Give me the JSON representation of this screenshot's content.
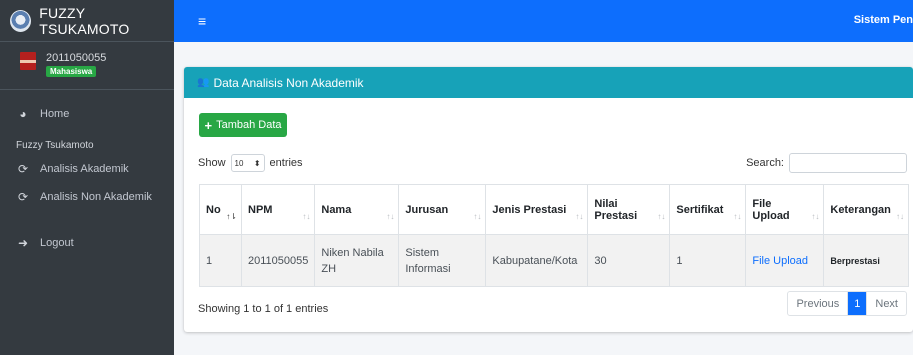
{
  "brand": {
    "name": "FUZZY TSUKAMOTO"
  },
  "user": {
    "id": "2011050055",
    "role": "Mahasiswa"
  },
  "nav": {
    "home": "Home",
    "section_header": "Fuzzy Tsukamoto",
    "analisis_akademik": "Analisis Akademik",
    "analisis_non_akademik": "Analisis Non Akademik",
    "logout": "Logout"
  },
  "topbar": {
    "system_title": "Sistem Pen"
  },
  "card": {
    "title": "Data Analisis Non Akademik",
    "add_button": "Tambah Data"
  },
  "datatable": {
    "show_label": "Show",
    "length_value": "10",
    "entries_label": "entries",
    "search_label": "Search:",
    "search_value": "",
    "columns": [
      "No",
      "NPM",
      "Nama",
      "Jurusan",
      "Jenis Prestasi",
      "Nilai Prestasi",
      "Sertifikat",
      "File Upload",
      "Keterangan"
    ],
    "rows": [
      {
        "no": "1",
        "npm": "2011050055",
        "nama": "Niken Nabila ZH",
        "jurusan": "Sistem Informasi",
        "jenis_prestasi": "Kabupatane/Kota",
        "nilai_prestasi": "30",
        "sertifikat": "1",
        "file_upload": "File Upload",
        "keterangan": "Berprestasi"
      }
    ],
    "info": "Showing 1 to 1 of 1 entries",
    "pagination": {
      "previous": "Previous",
      "current": "1",
      "next": "Next"
    }
  },
  "colors": {
    "sidebar": "#343a40",
    "topbar": "#0d6efd",
    "card_header": "#17a2b8",
    "success": "#28a745"
  }
}
